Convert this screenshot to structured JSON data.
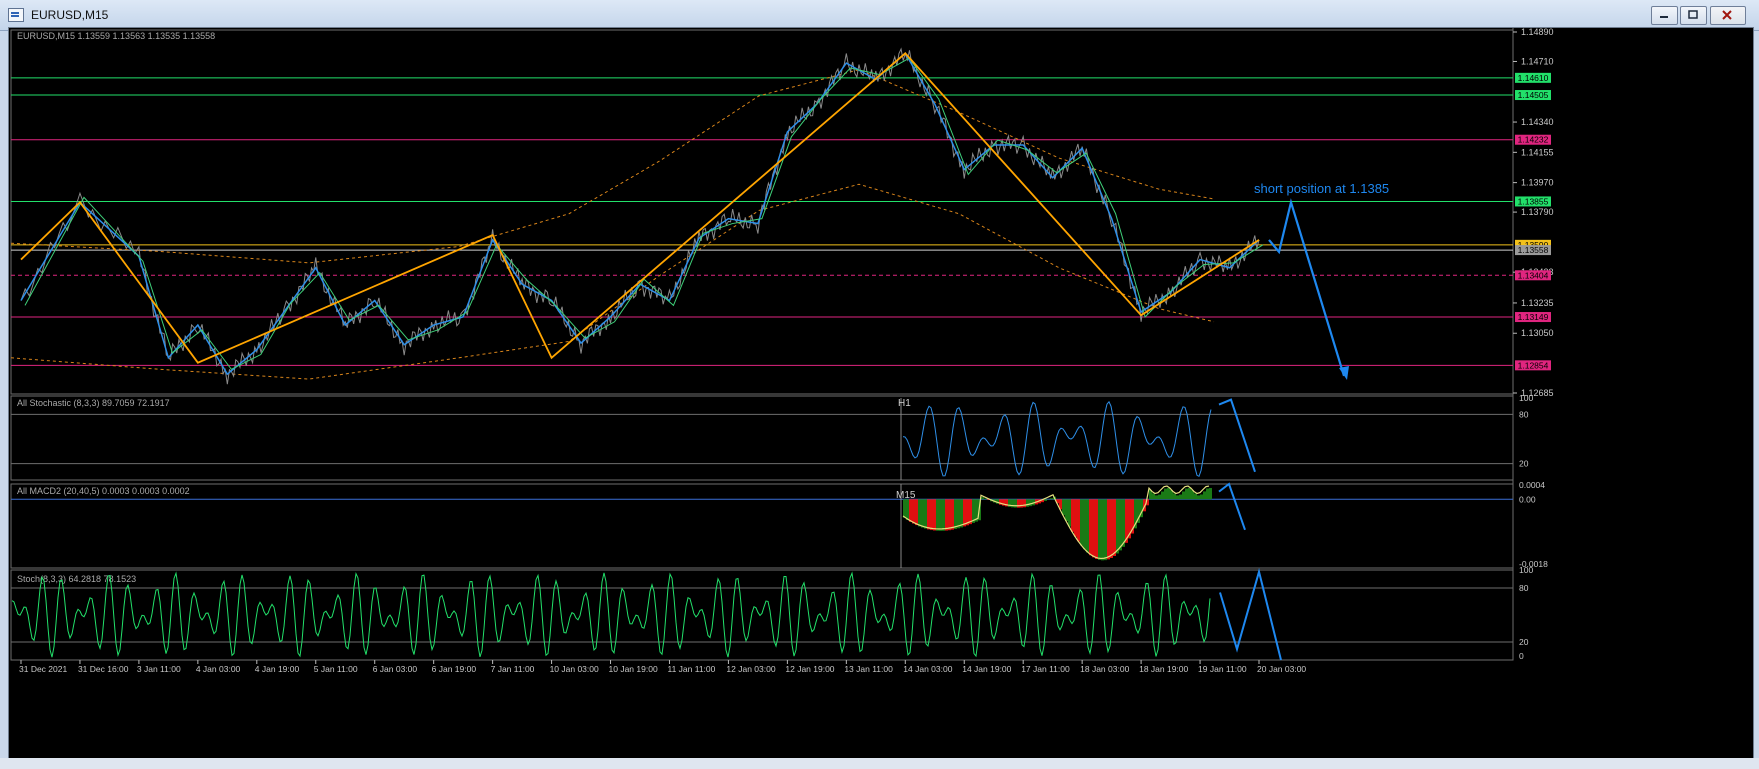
{
  "window": {
    "title": "EURUSD,M15"
  },
  "panels": {
    "main": {
      "header": "EURUSD,M15  1.13559 1.13563 1.13535 1.13558"
    },
    "stoch_h1": {
      "header": "All Stochastic (8,3,3) 89.7059 72.1917",
      "tf_label": "H1",
      "level_high": "80",
      "level_low": "20",
      "scale_top": "100"
    },
    "macd": {
      "header": "All MACD2 (20,40,5) 0.0003 0.0003 0.0002",
      "tf_label": "M15",
      "scale_top": "0.0004",
      "scale_zero": "0.00",
      "scale_bottom": "-0.0018"
    },
    "stoch_m15": {
      "header": "Stoch(8,3,3) 64.2818 78.1523",
      "level_high": "80",
      "level_low": "20",
      "scale_top": "100",
      "scale_bottom": "0"
    }
  },
  "annotation": {
    "text": "short position at 1.1385"
  },
  "colors": {
    "background": "#000000",
    "grid": "#6e6e6e",
    "price": "#8a8a8a",
    "zigzag_major": "#ffa500",
    "zigzag_minor": "#2e8fe8",
    "zigzag_green": "#3ecf79",
    "green_level": "#22e06a",
    "magenta_level": "#e0257f",
    "yellow_level": "#f2c11b",
    "arrow": "#1e88f0",
    "stoch_h1": "#2e8fe8",
    "stoch_m15": "#22e06a",
    "macd_pos": "#1a7a15",
    "macd_neg": "#e01010",
    "macd_line": "#e5e080"
  },
  "chart_data": {
    "type": "line",
    "symbol": "EURUSD",
    "timeframe": "M15",
    "ylim": [
      1.12685,
      1.1489
    ],
    "price_ticks": [
      "1.14890",
      "1.14710",
      "1.14340",
      "1.14155",
      "1.13970",
      "1.13790",
      "1.13423",
      "1.13235",
      "1.13050",
      "1.12685"
    ],
    "x_ticks": [
      "31 Dec 2021",
      "31 Dec 16:00",
      "3 Jan 11:00",
      "4 Jan 03:00",
      "4 Jan 19:00",
      "5 Jan 11:00",
      "6 Jan 03:00",
      "6 Jan 19:00",
      "7 Jan 11:00",
      "10 Jan 03:00",
      "10 Jan 19:00",
      "11 Jan 11:00",
      "12 Jan 03:00",
      "12 Jan 19:00",
      "13 Jan 11:00",
      "14 Jan 03:00",
      "14 Jan 19:00",
      "17 Jan 11:00",
      "18 Jan 03:00",
      "18 Jan 19:00",
      "19 Jan 11:00",
      "20 Jan 03:00"
    ],
    "levels": [
      {
        "price": 1.1461,
        "label": "1.14610",
        "color": "green"
      },
      {
        "price": 1.14505,
        "label": "1.14505",
        "color": "green"
      },
      {
        "price": 1.14232,
        "label": "1.14232",
        "color": "magenta"
      },
      {
        "price": 1.13855,
        "label": "1.13855",
        "color": "green"
      },
      {
        "price": 1.1359,
        "label": "1.13590",
        "color": "yellow"
      },
      {
        "price": 1.13558,
        "label": "1.13558",
        "color": "white"
      },
      {
        "price": 1.13404,
        "label": "1.13404",
        "color": "magenta_dashed"
      },
      {
        "price": 1.13149,
        "label": "1.13149",
        "color": "magenta"
      },
      {
        "price": 1.12854,
        "label": "1.12854",
        "color": "magenta"
      }
    ],
    "price_series": [
      [
        "31 Dec 2021",
        1.1325
      ],
      [
        "31 Dec 16:00",
        1.1385
      ],
      [
        "3 Jan 11:00",
        1.1352
      ],
      [
        "3 Jan 19:00",
        1.129
      ],
      [
        "4 Jan 03:00",
        1.131
      ],
      [
        "4 Jan 11:00",
        1.128
      ],
      [
        "4 Jan 19:00",
        1.1295
      ],
      [
        "5 Jan 03:00",
        1.132
      ],
      [
        "5 Jan 11:00",
        1.1345
      ],
      [
        "5 Jan 19:00",
        1.131
      ],
      [
        "6 Jan 03:00",
        1.1325
      ],
      [
        "6 Jan 11:00",
        1.1298
      ],
      [
        "6 Jan 19:00",
        1.131
      ],
      [
        "7 Jan 03:00",
        1.1315
      ],
      [
        "7 Jan 11:00",
        1.1362
      ],
      [
        "7 Jan 19:00",
        1.1335
      ],
      [
        "10 Jan 03:00",
        1.1325
      ],
      [
        "10 Jan 11:00",
        1.1299
      ],
      [
        "10 Jan 19:00",
        1.1315
      ],
      [
        "11 Jan 03:00",
        1.1335
      ],
      [
        "11 Jan 11:00",
        1.1325
      ],
      [
        "11 Jan 19:00",
        1.1363
      ],
      [
        "12 Jan 03:00",
        1.1375
      ],
      [
        "12 Jan 11:00",
        1.1372
      ],
      [
        "12 Jan 19:00",
        1.1428
      ],
      [
        "13 Jan 03:00",
        1.1445
      ],
      [
        "13 Jan 11:00",
        1.147
      ],
      [
        "13 Jan 19:00",
        1.146
      ],
      [
        "14 Jan 03:00",
        1.1476
      ],
      [
        "14 Jan 11:00",
        1.1445
      ],
      [
        "14 Jan 19:00",
        1.1405
      ],
      [
        "15 Jan 03:00",
        1.142
      ],
      [
        "17 Jan 11:00",
        1.142
      ],
      [
        "17 Jan 19:00",
        1.14
      ],
      [
        "18 Jan 03:00",
        1.1418
      ],
      [
        "18 Jan 11:00",
        1.1375
      ],
      [
        "18 Jan 19:00",
        1.1318
      ],
      [
        "19 Jan 03:00",
        1.133
      ],
      [
        "19 Jan 11:00",
        1.135
      ],
      [
        "19 Jan 19:00",
        1.1345
      ],
      [
        "20 Jan 03:00",
        1.1362
      ]
    ],
    "zigzag_major": [
      [
        "31 Dec 2021",
        1.135
      ],
      [
        "31 Dec 16:00",
        1.1385
      ],
      [
        "4 Jan 03:00",
        1.1287
      ],
      [
        "7 Jan 11:00",
        1.1365
      ],
      [
        "10 Jan 03:00",
        1.129
      ],
      [
        "14 Jan 03:00",
        1.1476
      ],
      [
        "18 Jan 19:00",
        1.1316
      ],
      [
        "20 Jan 03:00",
        1.1362
      ]
    ],
    "projection": [
      [
        "20 Jan 03:00",
        1.1362
      ],
      [
        "20 Jan 11:00",
        1.1385
      ],
      [
        "21 Jan 11:00",
        1.1285
      ]
    ],
    "indicators": {
      "stochastic_h1": {
        "k": 89.7059,
        "d": 72.1917,
        "levels": [
          20,
          80
        ],
        "ylim": [
          0,
          100
        ]
      },
      "macd": {
        "params": "20,40,5",
        "values": [
          0.0003,
          0.0003,
          0.0002
        ],
        "ylim": [
          -0.0018,
          0.0004
        ]
      },
      "stochastic_m15": {
        "k": 64.2818,
        "d": 78.1523,
        "levels": [
          20,
          80
        ],
        "ylim": [
          0,
          100
        ]
      }
    },
    "annotations": [
      "short position at 1.1385"
    ]
  }
}
